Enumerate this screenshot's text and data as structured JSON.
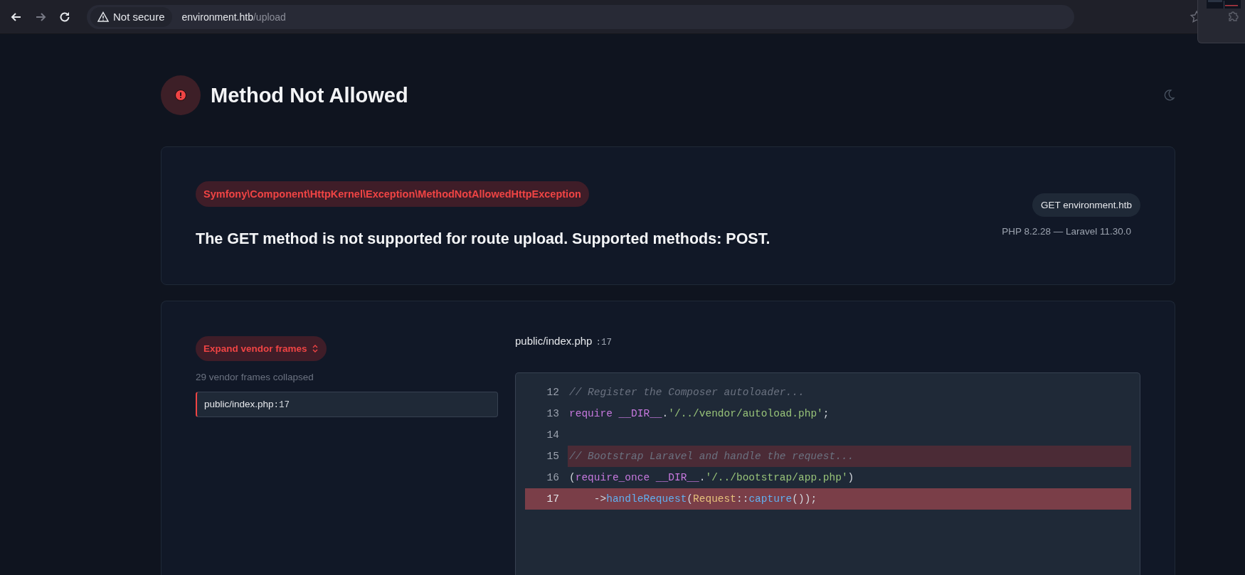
{
  "browser": {
    "security_label": "Not secure",
    "url_host": "environment.htb",
    "url_path": "/upload"
  },
  "header": {
    "title": "Method Not Allowed"
  },
  "exception": {
    "class": "Symfony\\Component\\HttpKernel\\Exception\\MethodNotAllowedHttpException",
    "message": "The GET method is not supported for route upload. Supported methods: POST.",
    "request": "GET environment.htb",
    "versions": "PHP 8.2.28 — Laravel 11.30.0"
  },
  "trace": {
    "expand_button": "Expand vendor frames",
    "collapsed_note": "29 vendor frames collapsed",
    "frames": [
      {
        "file": "public/index.php",
        "line": ":17",
        "selected": true
      }
    ],
    "file_header": {
      "file": "public/index.php",
      "line": ":17"
    },
    "code": [
      {
        "number": "12",
        "highlighted": false,
        "error": false,
        "tokens": [
          {
            "kind": "comment",
            "text": "// Register the Composer autoloader..."
          }
        ]
      },
      {
        "number": "13",
        "highlighted": false,
        "error": false,
        "tokens": [
          {
            "kind": "keyword",
            "text": "require"
          },
          {
            "kind": "keyword",
            "text": " __DIR__"
          },
          {
            "kind": "plain",
            "text": "."
          },
          {
            "kind": "string",
            "text": "'/../vendor/autoload.php'"
          },
          {
            "kind": "plain",
            "text": ";"
          }
        ]
      },
      {
        "number": "14",
        "highlighted": false,
        "error": false
      },
      {
        "number": "15",
        "highlighted": true,
        "error": false,
        "tokens": [
          {
            "kind": "comment",
            "text": "// Bootstrap Laravel and handle the request..."
          }
        ]
      },
      {
        "number": "16",
        "highlighted": false,
        "error": false,
        "tokens": [
          {
            "kind": "plain",
            "text": "("
          },
          {
            "kind": "keyword",
            "text": "require_once"
          },
          {
            "kind": "keyword",
            "text": " __DIR__"
          },
          {
            "kind": "plain",
            "text": "."
          },
          {
            "kind": "string",
            "text": "'/../bootstrap/app.php'"
          },
          {
            "kind": "plain",
            "text": ")"
          }
        ]
      },
      {
        "number": "17",
        "highlighted": true,
        "error": true,
        "tokens": [
          {
            "kind": "plain",
            "text": "    ->"
          },
          {
            "kind": "method",
            "text": "handleRequest"
          },
          {
            "kind": "plain",
            "text": "("
          },
          {
            "kind": "class",
            "text": "Request"
          },
          {
            "kind": "plain",
            "text": "::"
          },
          {
            "kind": "method",
            "text": "capture"
          },
          {
            "kind": "plain",
            "text": "());"
          }
        ]
      }
    ]
  }
}
